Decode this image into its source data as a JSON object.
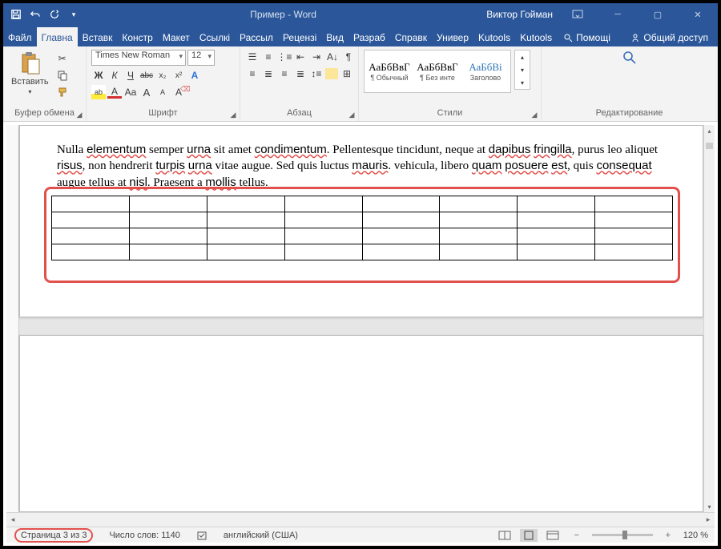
{
  "title": "Пример  -  Word",
  "user": "Виктор Гойман",
  "qat": {
    "save": "save",
    "undo": "undo",
    "redo": "redo",
    "customize": "customize"
  },
  "tabs": [
    "Файл",
    "Главна",
    "Вставк",
    "Констр",
    "Макет",
    "Ссылкі",
    "Рассыл",
    "Рецензі",
    "Вид",
    "Разраб",
    "Справк",
    "Универ",
    "Kutools",
    "Kutools"
  ],
  "active_tab": 1,
  "help_label": "Помощі",
  "share_label": "Общий доступ",
  "ribbon": {
    "clipboard": {
      "label": "Буфер обмена",
      "paste": "Вставить"
    },
    "font": {
      "label": "Шрифт",
      "name": "Times New Roman",
      "size": "12",
      "bold": "Ж",
      "italic": "К",
      "underline": "Ч",
      "strike": "abc",
      "sub": "x₂",
      "sup": "x²",
      "effects": "A",
      "highlight": "ab",
      "color": "A",
      "grow": "A",
      "shrink": "A",
      "case": "Aa",
      "clear": "A"
    },
    "paragraph": {
      "label": "Абзац"
    },
    "styles": {
      "label": "Стили",
      "items": [
        {
          "preview": "АаБбВвГ",
          "name": "¶ Обычный"
        },
        {
          "preview": "АаБбВвГ",
          "name": "¶ Без инте"
        },
        {
          "preview": "АаБбВі",
          "name": "Заголово"
        }
      ]
    },
    "editing": {
      "label": "Редактирование"
    }
  },
  "document": {
    "paragraph": "Nulla elementum semper urna sit amet condimentum. Pellentesque tincidunt, neque at dapibus fringilla, purus leo aliquet risus, non hendrerit turpis urna vitae augue. Sed quis luctus mauris. vehicula, libero quam posuere est, quis consequat augue tellus at nisl. Praesent a mollis tellus.",
    "squiggled": [
      "elementum",
      "urna",
      "condimentum",
      "dapibus",
      "fringilla",
      "risus",
      "turpis",
      "urna",
      "mauris",
      "quam",
      "posuere",
      "est",
      "consequat",
      "nisl",
      "mollis"
    ],
    "table": {
      "rows": 4,
      "cols": 8
    }
  },
  "status": {
    "page": "Страница 3 из 3",
    "words": "Число слов: 1140",
    "lang": "английский (США)",
    "zoom": "120 %"
  }
}
